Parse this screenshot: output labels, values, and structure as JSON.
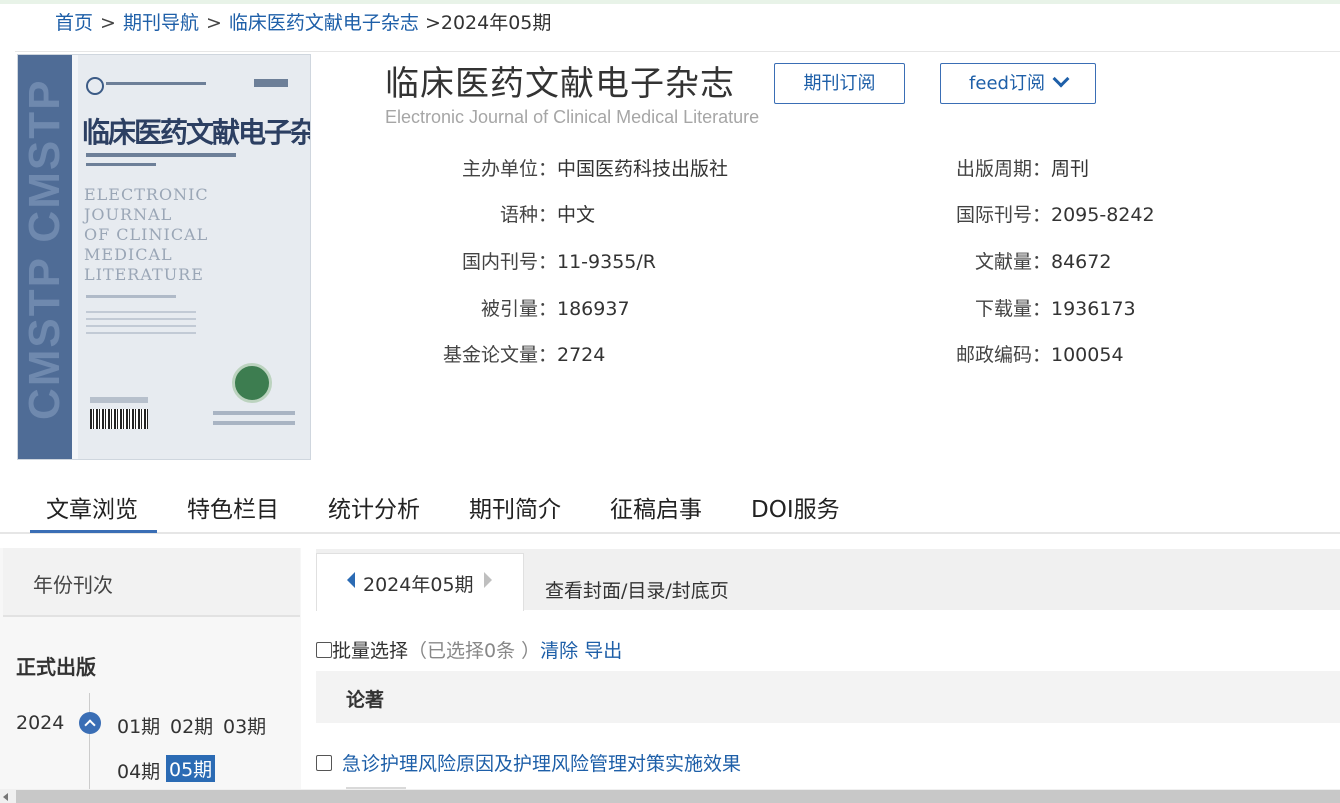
{
  "breadcrumb": {
    "home": "首页",
    "sep": ">",
    "nav": "期刊导航",
    "journal": "临床医药文献电子杂志",
    "current": ">2024年05期"
  },
  "journal": {
    "title": "临床医药文献电子杂志",
    "subtitle": "Electronic Journal of Clinical Medical Literature",
    "subscribe_label": "期刊订阅",
    "feed_label": "feed订阅"
  },
  "cover": {
    "band_text": "CMSTP CMSTP",
    "title_art": "临床医药文献电子杂志",
    "english_lines": [
      "ELECTRONIC",
      "JOURNAL",
      "OF CLINICAL",
      "MEDICAL",
      "LITERATURE"
    ]
  },
  "info": {
    "left": [
      {
        "label": "主办单位：",
        "value": "中国医药科技出版社"
      },
      {
        "label": "语种：",
        "value": "中文"
      },
      {
        "label": "国内刊号：",
        "value": "11-9355/R"
      },
      {
        "label": "被引量：",
        "value": "186937"
      },
      {
        "label": "基金论文量：",
        "value": "2724"
      }
    ],
    "right": [
      {
        "label": "出版周期：",
        "value": "周刊"
      },
      {
        "label": "国际刊号：",
        "value": "2095-8242"
      },
      {
        "label": "文献量：",
        "value": "84672"
      },
      {
        "label": "下载量：",
        "value": "1936173"
      },
      {
        "label": "邮政编码：",
        "value": "100054"
      }
    ]
  },
  "tabs": [
    "文章浏览",
    "特色栏目",
    "统计分析",
    "期刊简介",
    "征稿启事",
    "DOI服务"
  ],
  "sidebar": {
    "header": "年份刊次",
    "formal": "正式出版",
    "year": "2024",
    "issues": [
      "01期",
      "02期",
      "03期",
      "04期",
      "05期"
    ],
    "active_issue": "05期"
  },
  "content": {
    "issue_tab": "2024年05期",
    "cover_tab": "查看封面/目录/封底页",
    "batch_label": "批量选择",
    "batch_status": "（已选择0条 ）",
    "clear_label": "清除",
    "export_label": "导出",
    "section": "论著",
    "article_title": "急诊护理风险原因及护理风险管理对策实施效果"
  },
  "colors": {
    "link": "#1e5fa8",
    "accent": "#3a6eb5",
    "active_issue_bg": "#2b6bb4"
  }
}
